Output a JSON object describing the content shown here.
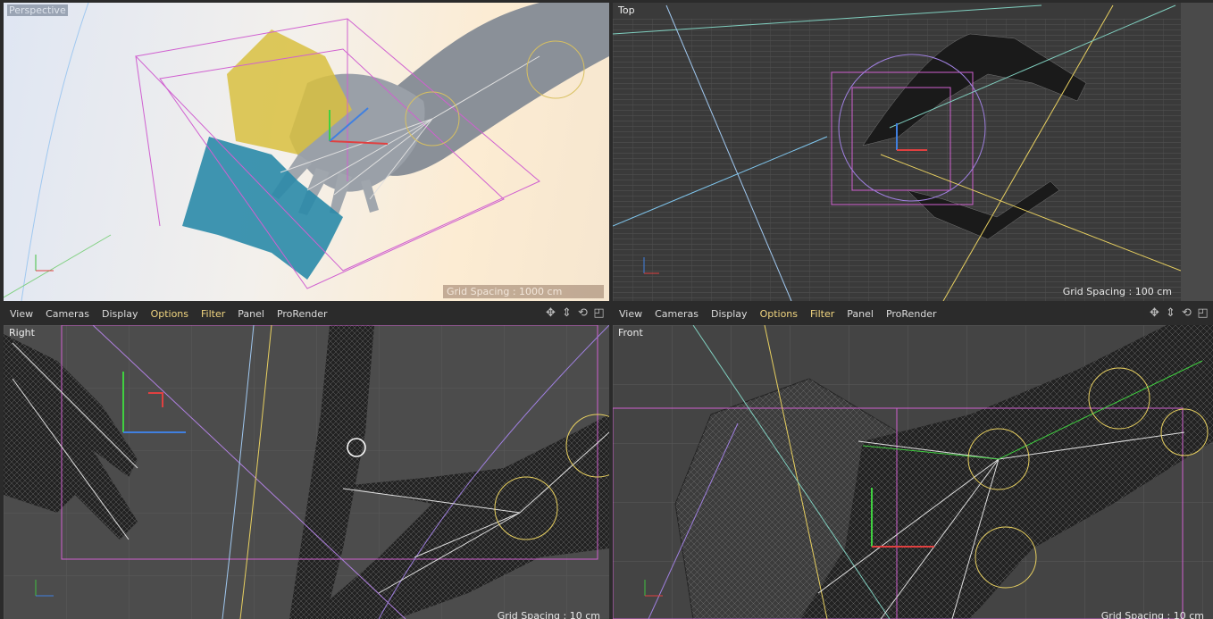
{
  "viewports": {
    "perspective": {
      "label": "Perspective",
      "grid_spacing": "Grid Spacing : 1000 cm"
    },
    "top": {
      "label": "Top",
      "grid_spacing": "Grid Spacing : 100 cm"
    },
    "right": {
      "label": "Right",
      "grid_spacing": "Grid Spacing : 10 cm"
    },
    "front": {
      "label": "Front",
      "grid_spacing": "Grid Spacing : 10 cm"
    }
  },
  "menubar": {
    "items": [
      "View",
      "Cameras",
      "Display",
      "Options",
      "Filter",
      "Panel",
      "ProRender"
    ]
  },
  "axes": {
    "perspective": {
      "v": "Y",
      "h": "X",
      "z": "Z"
    },
    "top": {
      "v": "Z",
      "h": "X"
    },
    "right": {
      "v": "Y",
      "h": "Z"
    },
    "front": {
      "v": "Y",
      "h": "X"
    }
  },
  "icons": [
    "move-view-icon",
    "zoom-view-icon",
    "rotate-view-icon",
    "maximize-view-icon"
  ],
  "colors": {
    "highlight_menu": "#f2d680",
    "selection_box": "#e070e0",
    "bone_yellow": "#e8d060",
    "axis_y": "#40d040",
    "axis_x": "#e04040",
    "axis_z": "#4080e0"
  }
}
